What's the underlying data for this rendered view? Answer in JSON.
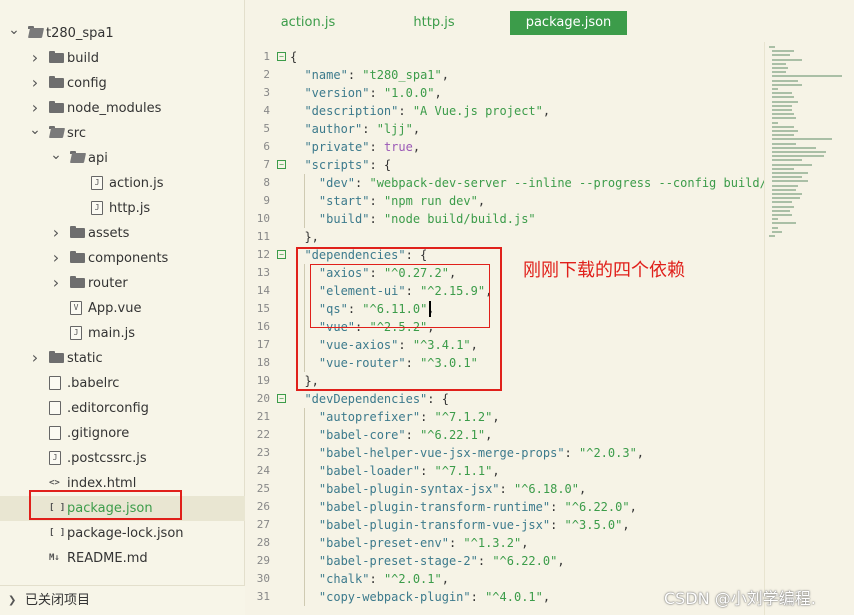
{
  "sidebar": {
    "tree": [
      {
        "label": "t280_spa1",
        "depth": 0,
        "kind": "folder",
        "expanded": true
      },
      {
        "label": "build",
        "depth": 1,
        "kind": "folder",
        "expanded": false
      },
      {
        "label": "config",
        "depth": 1,
        "kind": "folder",
        "expanded": false
      },
      {
        "label": "node_modules",
        "depth": 1,
        "kind": "folder",
        "expanded": false
      },
      {
        "label": "src",
        "depth": 1,
        "kind": "folder",
        "expanded": true
      },
      {
        "label": "api",
        "depth": 2,
        "kind": "folder",
        "expanded": true
      },
      {
        "label": "action.js",
        "depth": 3,
        "kind": "file",
        "glyph": "J"
      },
      {
        "label": "http.js",
        "depth": 3,
        "kind": "file",
        "glyph": "J"
      },
      {
        "label": "assets",
        "depth": 2,
        "kind": "folder",
        "expanded": false
      },
      {
        "label": "components",
        "depth": 2,
        "kind": "folder",
        "expanded": false
      },
      {
        "label": "router",
        "depth": 2,
        "kind": "folder",
        "expanded": false
      },
      {
        "label": "App.vue",
        "depth": 2,
        "kind": "file",
        "glyph": "V"
      },
      {
        "label": "main.js",
        "depth": 2,
        "kind": "file",
        "glyph": "J"
      },
      {
        "label": "static",
        "depth": 1,
        "kind": "folder",
        "expanded": false
      },
      {
        "label": ".babelrc",
        "depth": 1,
        "kind": "file",
        "glyph": ""
      },
      {
        "label": ".editorconfig",
        "depth": 1,
        "kind": "file",
        "glyph": ""
      },
      {
        "label": ".gitignore",
        "depth": 1,
        "kind": "file",
        "glyph": ""
      },
      {
        "label": ".postcssrc.js",
        "depth": 1,
        "kind": "file",
        "glyph": "J"
      },
      {
        "label": "index.html",
        "depth": 1,
        "kind": "glyph",
        "glyph": "<>"
      },
      {
        "label": "package.json",
        "depth": 1,
        "kind": "glyph",
        "glyph": "[ ]",
        "selected": true
      },
      {
        "label": "package-lock.json",
        "depth": 1,
        "kind": "glyph",
        "glyph": "[ ]"
      },
      {
        "label": "README.md",
        "depth": 1,
        "kind": "glyph",
        "glyph": "M↓"
      }
    ],
    "footer_label": "已关闭项目"
  },
  "tabs": [
    {
      "label": "action.js",
      "active": false
    },
    {
      "label": "http.js",
      "active": false
    },
    {
      "label": "package.json",
      "active": true
    }
  ],
  "editor": {
    "lines": [
      {
        "n": "1",
        "fold": "−",
        "tokens": [
          [
            "p",
            "{"
          ]
        ]
      },
      {
        "n": "2",
        "tokens": [
          [
            "p",
            "  "
          ],
          [
            "k",
            "\"name\""
          ],
          [
            "p",
            ": "
          ],
          [
            "s",
            "\"t280_spa1\""
          ],
          [
            "p",
            ","
          ]
        ]
      },
      {
        "n": "3",
        "tokens": [
          [
            "p",
            "  "
          ],
          [
            "k",
            "\"version\""
          ],
          [
            "p",
            ": "
          ],
          [
            "s",
            "\"1.0.0\""
          ],
          [
            "p",
            ","
          ]
        ]
      },
      {
        "n": "4",
        "tokens": [
          [
            "p",
            "  "
          ],
          [
            "k",
            "\"description\""
          ],
          [
            "p",
            ": "
          ],
          [
            "s",
            "\"A Vue.js project\""
          ],
          [
            "p",
            ","
          ]
        ]
      },
      {
        "n": "5",
        "tokens": [
          [
            "p",
            "  "
          ],
          [
            "k",
            "\"author\""
          ],
          [
            "p",
            ": "
          ],
          [
            "s",
            "\"ljj\""
          ],
          [
            "p",
            ","
          ]
        ]
      },
      {
        "n": "6",
        "tokens": [
          [
            "p",
            "  "
          ],
          [
            "k",
            "\"private\""
          ],
          [
            "p",
            ": "
          ],
          [
            "b",
            "true"
          ],
          [
            "p",
            ","
          ]
        ]
      },
      {
        "n": "7",
        "fold": "−",
        "tokens": [
          [
            "p",
            "  "
          ],
          [
            "k",
            "\"scripts\""
          ],
          [
            "p",
            ": {"
          ]
        ]
      },
      {
        "n": "8",
        "tokens": [
          [
            "p",
            "    "
          ],
          [
            "k",
            "\"dev\""
          ],
          [
            "p",
            ": "
          ],
          [
            "s",
            "\"webpack-dev-server --inline --progress --config build/webpack.dev.conf.js\""
          ],
          [
            "p",
            ","
          ]
        ]
      },
      {
        "n": "9",
        "tokens": [
          [
            "p",
            "    "
          ],
          [
            "k",
            "\"start\""
          ],
          [
            "p",
            ": "
          ],
          [
            "s",
            "\"npm run dev\""
          ],
          [
            "p",
            ","
          ]
        ]
      },
      {
        "n": "10",
        "tokens": [
          [
            "p",
            "    "
          ],
          [
            "k",
            "\"build\""
          ],
          [
            "p",
            ": "
          ],
          [
            "s",
            "\"node build/build.js\""
          ]
        ]
      },
      {
        "n": "11",
        "tokens": [
          [
            "p",
            "  },"
          ]
        ]
      },
      {
        "n": "12",
        "fold": "−",
        "tokens": [
          [
            "p",
            "  "
          ],
          [
            "k",
            "\"dependencies\""
          ],
          [
            "p",
            ": {"
          ]
        ]
      },
      {
        "n": "13",
        "tokens": [
          [
            "p",
            "    "
          ],
          [
            "k",
            "\"axios\""
          ],
          [
            "p",
            ": "
          ],
          [
            "s",
            "\"^0.27.2\""
          ],
          [
            "p",
            ","
          ]
        ]
      },
      {
        "n": "14",
        "tokens": [
          [
            "p",
            "    "
          ],
          [
            "k",
            "\"element-ui\""
          ],
          [
            "p",
            ": "
          ],
          [
            "s",
            "\"^2.15.9\""
          ],
          [
            "p",
            ","
          ]
        ]
      },
      {
        "n": "15",
        "tokens": [
          [
            "p",
            "    "
          ],
          [
            "k",
            "\"qs\""
          ],
          [
            "p",
            ": "
          ],
          [
            "s",
            "\"^6.11.0\""
          ],
          [
            "p",
            ","
          ]
        ]
      },
      {
        "n": "16",
        "tokens": [
          [
            "p",
            "    "
          ],
          [
            "k",
            "\"vue\""
          ],
          [
            "p",
            ": "
          ],
          [
            "s",
            "\"^2.5.2\""
          ],
          [
            "p",
            ","
          ]
        ]
      },
      {
        "n": "17",
        "tokens": [
          [
            "p",
            "    "
          ],
          [
            "k",
            "\"vue-axios\""
          ],
          [
            "p",
            ": "
          ],
          [
            "s",
            "\"^3.4.1\""
          ],
          [
            "p",
            ","
          ]
        ]
      },
      {
        "n": "18",
        "tokens": [
          [
            "p",
            "    "
          ],
          [
            "k",
            "\"vue-router\""
          ],
          [
            "p",
            ": "
          ],
          [
            "s",
            "\"^3.0.1\""
          ]
        ]
      },
      {
        "n": "19",
        "tokens": [
          [
            "p",
            "  },"
          ]
        ]
      },
      {
        "n": "20",
        "fold": "−",
        "tokens": [
          [
            "p",
            "  "
          ],
          [
            "k",
            "\"devDependencies\""
          ],
          [
            "p",
            ": {"
          ]
        ]
      },
      {
        "n": "21",
        "tokens": [
          [
            "p",
            "    "
          ],
          [
            "k",
            "\"autoprefixer\""
          ],
          [
            "p",
            ": "
          ],
          [
            "s",
            "\"^7.1.2\""
          ],
          [
            "p",
            ","
          ]
        ]
      },
      {
        "n": "22",
        "tokens": [
          [
            "p",
            "    "
          ],
          [
            "k",
            "\"babel-core\""
          ],
          [
            "p",
            ": "
          ],
          [
            "s",
            "\"^6.22.1\""
          ],
          [
            "p",
            ","
          ]
        ]
      },
      {
        "n": "23",
        "tokens": [
          [
            "p",
            "    "
          ],
          [
            "k",
            "\"babel-helper-vue-jsx-merge-props\""
          ],
          [
            "p",
            ": "
          ],
          [
            "s",
            "\"^2.0.3\""
          ],
          [
            "p",
            ","
          ]
        ]
      },
      {
        "n": "24",
        "tokens": [
          [
            "p",
            "    "
          ],
          [
            "k",
            "\"babel-loader\""
          ],
          [
            "p",
            ": "
          ],
          [
            "s",
            "\"^7.1.1\""
          ],
          [
            "p",
            ","
          ]
        ]
      },
      {
        "n": "25",
        "tokens": [
          [
            "p",
            "    "
          ],
          [
            "k",
            "\"babel-plugin-syntax-jsx\""
          ],
          [
            "p",
            ": "
          ],
          [
            "s",
            "\"^6.18.0\""
          ],
          [
            "p",
            ","
          ]
        ]
      },
      {
        "n": "26",
        "tokens": [
          [
            "p",
            "    "
          ],
          [
            "k",
            "\"babel-plugin-transform-runtime\""
          ],
          [
            "p",
            ": "
          ],
          [
            "s",
            "\"^6.22.0\""
          ],
          [
            "p",
            ","
          ]
        ]
      },
      {
        "n": "27",
        "tokens": [
          [
            "p",
            "    "
          ],
          [
            "k",
            "\"babel-plugin-transform-vue-jsx\""
          ],
          [
            "p",
            ": "
          ],
          [
            "s",
            "\"^3.5.0\""
          ],
          [
            "p",
            ","
          ]
        ]
      },
      {
        "n": "28",
        "tokens": [
          [
            "p",
            "    "
          ],
          [
            "k",
            "\"babel-preset-env\""
          ],
          [
            "p",
            ": "
          ],
          [
            "s",
            "\"^1.3.2\""
          ],
          [
            "p",
            ","
          ]
        ]
      },
      {
        "n": "29",
        "tokens": [
          [
            "p",
            "    "
          ],
          [
            "k",
            "\"babel-preset-stage-2\""
          ],
          [
            "p",
            ": "
          ],
          [
            "s",
            "\"^6.22.0\""
          ],
          [
            "p",
            ","
          ]
        ]
      },
      {
        "n": "30",
        "tokens": [
          [
            "p",
            "    "
          ],
          [
            "k",
            "\"chalk\""
          ],
          [
            "p",
            ": "
          ],
          [
            "s",
            "\"^2.0.1\""
          ],
          [
            "p",
            ","
          ]
        ]
      },
      {
        "n": "31",
        "tokens": [
          [
            "p",
            "    "
          ],
          [
            "k",
            "\"copy-webpack-plugin\""
          ],
          [
            "p",
            ": "
          ],
          [
            "s",
            "\"^4.0.1\""
          ],
          [
            "p",
            ","
          ]
        ]
      }
    ]
  },
  "annotation": "刚刚下载的四个依赖",
  "watermark": "CSDN @小刘学编程.",
  "colors": {
    "accent": "#3c9c4a",
    "highlight_box": "#e0201b",
    "background": "#f6f3e6"
  },
  "icons": {
    "folder": "folder-icon",
    "folder_open": "folder-open-icon",
    "js_file": "js-file-icon",
    "vue_file": "vue-file-icon",
    "generic_file": "file-icon",
    "html_file": "html-file-icon",
    "json_file": "json-file-icon",
    "markdown_file": "markdown-file-icon",
    "chevron_right": "chevron-right-icon",
    "chevron_down": "chevron-down-icon"
  }
}
